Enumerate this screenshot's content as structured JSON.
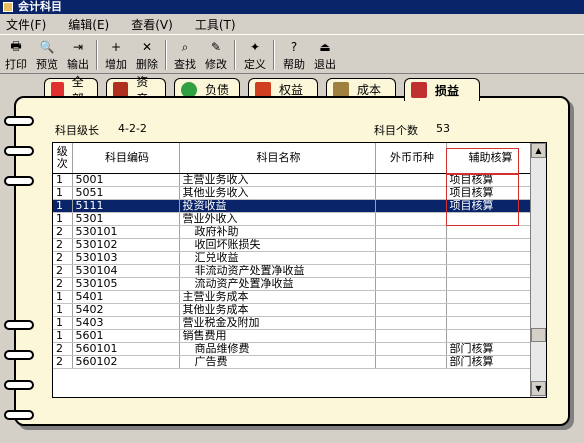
{
  "window": {
    "title": "会计科目"
  },
  "menu": [
    {
      "label": "文件(F)"
    },
    {
      "label": "编辑(E)"
    },
    {
      "label": "查看(V)"
    },
    {
      "label": "工具(T)"
    }
  ],
  "toolbar": [
    {
      "label": "打印",
      "icon": "print-icon"
    },
    {
      "label": "预览",
      "icon": "preview-icon"
    },
    {
      "label": "输出",
      "icon": "export-icon"
    },
    {
      "label": "增加",
      "icon": "add-icon"
    },
    {
      "label": "删除",
      "icon": "delete-icon"
    },
    {
      "label": "查找",
      "icon": "find-icon"
    },
    {
      "label": "修改",
      "icon": "edit-icon"
    },
    {
      "label": "定义",
      "icon": "define-icon"
    },
    {
      "label": "帮助",
      "icon": "help-icon"
    },
    {
      "label": "退出",
      "icon": "exit-icon"
    }
  ],
  "tabs": [
    {
      "label": "全部",
      "icon_color": "#e03030"
    },
    {
      "label": "资产",
      "icon_color": "#b03020"
    },
    {
      "label": "负债",
      "icon_color": "#30a040"
    },
    {
      "label": "权益",
      "icon_color": "#d04020"
    },
    {
      "label": "成本",
      "icon_color": "#a08040"
    },
    {
      "label": "损益",
      "icon_color": "#c03030",
      "active": true
    }
  ],
  "info": {
    "level_label": "科目级长",
    "level_value": "4-2-2",
    "count_label": "科目个数",
    "count_value": "53"
  },
  "columns": [
    "级次",
    "科目编码",
    "科目名称",
    "外币币种",
    "辅助核算"
  ],
  "rows": [
    {
      "level": "1",
      "code": "5001",
      "name": "主营业务收入",
      "currency": "",
      "aux": "项目核算"
    },
    {
      "level": "1",
      "code": "5051",
      "name": "其他业务收入",
      "currency": "",
      "aux": "项目核算"
    },
    {
      "level": "1",
      "code": "5111",
      "name": "投资收益",
      "currency": "",
      "aux": "项目核算",
      "selected": true
    },
    {
      "level": "1",
      "code": "5301",
      "name": "营业外收入",
      "currency": "",
      "aux": ""
    },
    {
      "level": "2",
      "code": "530101",
      "name": "政府补助",
      "currency": "",
      "aux": ""
    },
    {
      "level": "2",
      "code": "530102",
      "name": "收回坏账损失",
      "currency": "",
      "aux": ""
    },
    {
      "level": "2",
      "code": "530103",
      "name": "汇兑收益",
      "currency": "",
      "aux": ""
    },
    {
      "level": "2",
      "code": "530104",
      "name": "非流动资产处置净收益",
      "currency": "",
      "aux": ""
    },
    {
      "level": "2",
      "code": "530105",
      "name": "流动资产处置净收益",
      "currency": "",
      "aux": ""
    },
    {
      "level": "1",
      "code": "5401",
      "name": "主营业务成本",
      "currency": "",
      "aux": ""
    },
    {
      "level": "1",
      "code": "5402",
      "name": "其他业务成本",
      "currency": "",
      "aux": ""
    },
    {
      "level": "1",
      "code": "5403",
      "name": "营业税金及附加",
      "currency": "",
      "aux": ""
    },
    {
      "level": "1",
      "code": "5601",
      "name": "销售费用",
      "currency": "",
      "aux": ""
    },
    {
      "level": "2",
      "code": "560101",
      "name": "商品维修费",
      "currency": "",
      "aux": "部门核算"
    },
    {
      "level": "2",
      "code": "560102",
      "name": "广告费",
      "currency": "",
      "aux": "部门核算"
    }
  ]
}
